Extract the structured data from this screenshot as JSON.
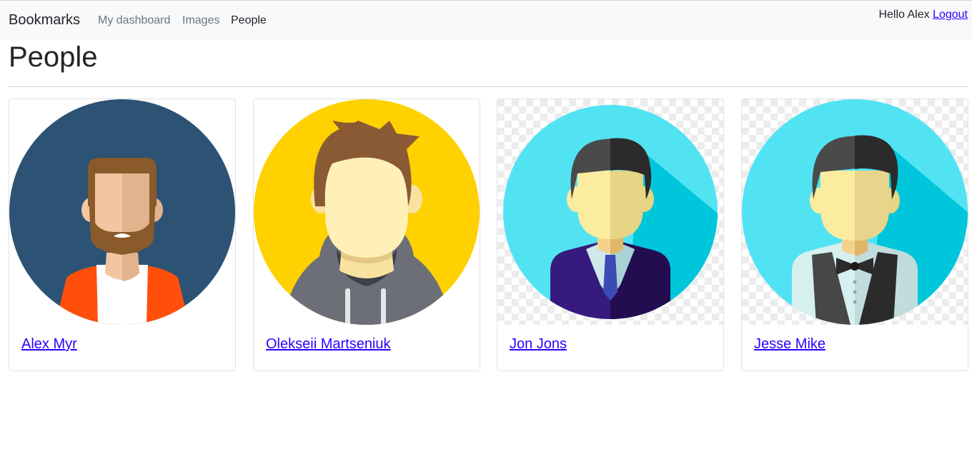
{
  "nav": {
    "brand": "Bookmarks",
    "links": [
      {
        "label": "My dashboard",
        "active": false
      },
      {
        "label": "Images",
        "active": false
      },
      {
        "label": "People",
        "active": true
      }
    ],
    "greeting": "Hello Alex",
    "logout": "Logout"
  },
  "page": {
    "title": "People"
  },
  "people": [
    {
      "name": "Alex Myr",
      "avatar_icon": "bearded-man-avatar-icon",
      "bg": "#2c5374"
    },
    {
      "name": "Oleksеii Martseniuk",
      "avatar_icon": "hoodie-man-avatar-icon",
      "bg": "#ffd100"
    },
    {
      "name": "Jon Jons",
      "avatar_icon": "businessman-avatar-icon",
      "bg": "#52e3f3"
    },
    {
      "name": "Jesse Mike",
      "avatar_icon": "bowtie-man-avatar-icon",
      "bg": "#52e3f3"
    }
  ],
  "colors": {
    "link": "#2b00ff",
    "navbar_bg": "#f8f9fa"
  }
}
